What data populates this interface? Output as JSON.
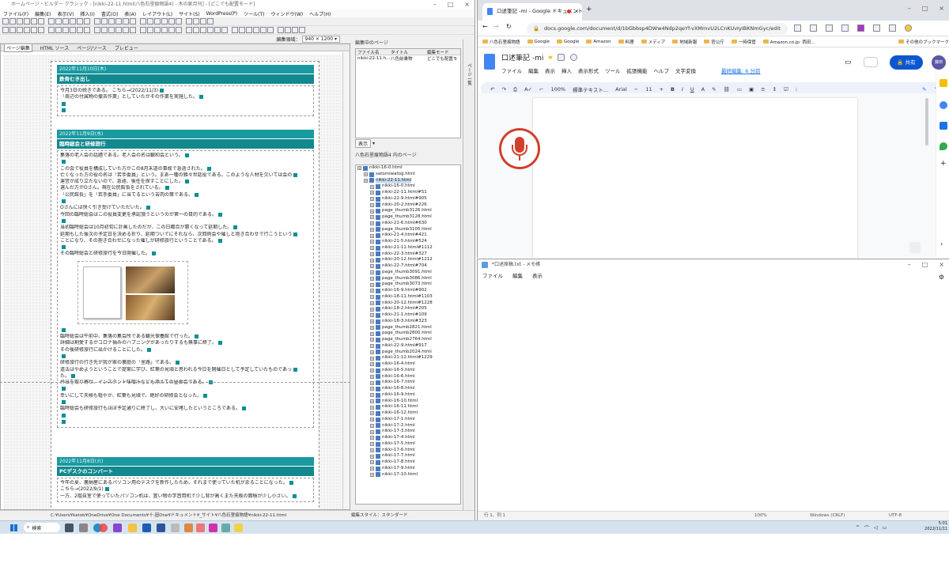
{
  "hpb": {
    "title": "ホームページ・ビルダー クラシック - [nikki-22-11.html(八色石里痕物語4) - 木の家月刊] - [どこでも配置モード]",
    "menu": [
      "ファイル(F)",
      "編集(E)",
      "表示(V)",
      "挿入(I)",
      "書式(O)",
      "表(A)",
      "レイアウト(L)",
      "サイト(S)",
      "WordPress(P)",
      "ツール(T)",
      "ウィンドウ(W)",
      "ヘルプ(H)"
    ],
    "edit_mode_label": "編集領域：",
    "edit_mode_value": "940 × 1200 ▾",
    "editor_tabs": [
      "ページ編集",
      "HTML ソース",
      "ページ/ソース",
      "プレビュー"
    ],
    "posts": [
      {
        "date": "2022年11月10日(木)",
        "title": "鉄骨むき出し",
        "lines": [
          "今月3日の続きである。 こちら→(2022/11/3)",
          "「周辺の付属物の撤去作業」としていたがその作業を実施した。",
          "",
          ""
        ]
      },
      {
        "date": "2022年11月9日(水)",
        "title": "臨時総会と研修旅行",
        "lines": [
          "集落の老人会の話題である。老人会の名は観和会という。",
          "",
          "この会で役員を構成していた方がこの8月末道の事故で急逝された。",
          "亡くなった方の役の名は「若手委員」という。まあ一種の雑々世話役である。このような人材を欠いては会の",
          "運営が成り立たないので、急遽、後任を探すことにした。",
          "選んだ方がOさん。現在公民館長をされている。",
          "「公民館長」を「若手委員」に当てるという苦肉の策である。",
          "",
          "Oさんには快く引き受けていただいた。",
          "今回の臨時総会はこの役員変更を承認頂うというのが第一の目的である。",
          "",
          "当初臨時総会は10月初旬に計画したのだが、この日都合が悪くなって延期した。",
          "延期もした後次の予定日を決める折り、延期ついでにそれなら、次回例会や催しと抱き合わせで行こうという",
          "ことになり、その抱き合わせになった催しが研修旅行ということである。",
          "",
          "その臨時総会と研修旅行を今日開催した。"
        ],
        "lines2": [
          "",
          "臨時総会は午前中、集落の集会所である観光保養館で行った。",
          "詳細は割愛するがコロナ禍みのハプニングがあったりするも無事に終了。",
          "その後研修旅行に出かけることにした。",
          "",
          "研修旅行の行き先が我が家の裏庭の「里路」である。",
          "道法はやめようということで提案に学び、紅葉の見頃と思われる今日を開催日として予定していたものであっ",
          "た。",
          "弁当を取り寄せ、インスタント味噌汁なども添えての昼食会である。",
          "",
          "幸いにして天候も穏やか、紅葉も見頃で、絶好の研修会となった。",
          "",
          "臨時総会も研修旅行もほぼ予定通りに終了し、大いに安堵したというところである。",
          "",
          ""
        ]
      },
      {
        "date": "2022年11月8日(火)",
        "title": "PCデスクのコンバート",
        "lines": [
          "今年の夏、裏納屋にあるパソコン用のデスクを新作したため、それまで使っていた机が余ることになった。",
          "こちら→(2022/9/1)",
          "一方、2階自室で使っていたパソコン机は、置い物の学習用机で少し背が高くまた天板の面積が少し小さい。"
        ]
      }
    ],
    "edit_pages_header": "編集中のページ",
    "edit_pages_cols": [
      "ファイル名",
      "タイトル",
      "編集モード"
    ],
    "edit_pages_row": [
      "nikki-22-11.h...",
      "八色前乗物",
      "どこでも配置モ"
    ],
    "display_btn": "表示",
    "tree_header": "八色石里痕物語4 内のページ",
    "tree": [
      "nikki-16-0.html",
      "satomiwatog.html",
      "nikki-22-11.html",
      "nikki-16-0.html",
      "nikki-22-11.html#S1",
      "nikki-22-9.html#905",
      "nikki-20-2.html#226",
      "page_thumb3126.html",
      "page_thumb3128.html",
      "nikki-21-6.html#630",
      "page_thumb3105.html",
      "nikki-21-4.html#421",
      "nikki-21-5.html#524",
      "nikki-21-11.html#1112",
      "nikki-22-3.html#327",
      "nikki-20-12.html#1212",
      "nikki-22-7.html#704",
      "page_thumb3091.html",
      "page_thumb3086.html",
      "page_thumb3073.html",
      "nikki-16-9.html#902",
      "nikki-18-11.html#1103",
      "nikki-20-12.html#1228",
      "nikki-18-2.html#205",
      "nikki-21-1.html#109",
      "nikki-18-3.html#323",
      "page_thumb2821.html",
      "page_thumb2800.html",
      "page_thumb2764.html",
      "nikki-22-9.html#917",
      "page_thumb2024.html",
      "nikki-21-12.html#1229",
      "nikki-16-4.html",
      "nikki-16-5.html",
      "nikki-16-6.html",
      "nikki-16-7.html",
      "nikki-16-8.html",
      "nikki-16-9.html",
      "nikki-16-10.html",
      "nikki-16-11.html",
      "nikki-16-12.html",
      "nikki-17-1.html",
      "nikki-17-2.html",
      "nikki-17-3.html",
      "nikki-17-4.html",
      "nikki-17-5.html",
      "nikki-17-6.html",
      "nikki-17-7.html",
      "nikki-17-8.html",
      "nikki-17-9.html",
      "nikki-17-10.html"
    ],
    "status_path": "C:¥Users¥katob¥OneDrive¥One Documents¥十-因One¥ドキュメント¥_サイト¥八色石里痕物語¥nikki-22-11.html",
    "status_style": "編集スタイル：スタンダード",
    "right_col_label": "ページ一覧"
  },
  "chrome": {
    "tab_title": "口述筆記 -mi - Google ドキュメント",
    "url": "docs.google.com/document/d/1bGbbsp4DWw4Ndp2qeYf-vXMmvU2LCnKUvIyIBKNmGyc/edit",
    "bookmarks": [
      "八色石里痕物語",
      "Google",
      "Google",
      "Amazon",
      "料理",
      "メディア",
      "地域新報",
      "官公庁",
      "一時保管",
      "Amazon.co.jp: 西田...",
      "その他のブックマーク"
    ],
    "doc_title": "口述筆記 -mi",
    "doc_menu": [
      "ファイル",
      "編集",
      "表示",
      "挿入",
      "表示形式",
      "ツール",
      "拡張機能",
      "ヘルプ",
      "文字変換"
    ],
    "last_edit": "最終編集: 6 分前",
    "share_label": "共有",
    "avatar": "藤田",
    "toolbar": {
      "zoom": "100%",
      "style": "標準テキスト...",
      "font": "Arial",
      "size": "11"
    },
    "ruler_marks": [
      "1",
      "2",
      "3",
      "4",
      "5",
      "6",
      "7",
      "8",
      "9",
      "10",
      "11",
      "12",
      "13",
      "14",
      "15",
      "16",
      "17",
      "18"
    ]
  },
  "notepad": {
    "title": "*口述原稿.txt - メモ帳",
    "menu": [
      "ファイル",
      "編集",
      "表示"
    ],
    "status": {
      "pos": "行 1、列 1",
      "zoom": "100%",
      "eol": "Windows (CRLF)",
      "enc": "UTF-8"
    }
  },
  "taskbar": {
    "search": "検索",
    "time": "5:01",
    "date": "2022/11/11"
  }
}
